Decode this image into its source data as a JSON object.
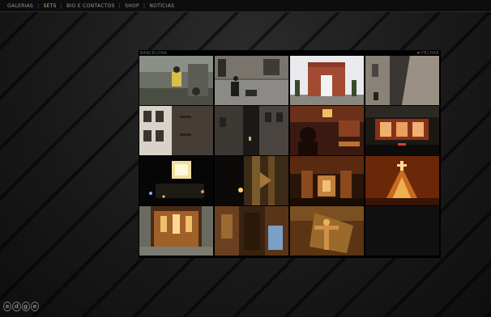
{
  "nav": {
    "items": [
      {
        "label": "GALERIAS",
        "active": false
      },
      {
        "label": "SETS",
        "active": true
      },
      {
        "label": "BIO E CONTACTOS",
        "active": false
      },
      {
        "label": "SHOP",
        "active": false
      },
      {
        "label": "NOTÍCIAS",
        "active": false
      }
    ],
    "separator": "|",
    "active_color": "#9ad14a"
  },
  "gallery": {
    "title": "BARCELONA",
    "close_label": "FECHAR",
    "close_icon": "x-icon",
    "thumbnails": [
      {
        "name": "street-performer"
      },
      {
        "name": "plaza-scooter"
      },
      {
        "name": "arc-de-triomf"
      },
      {
        "name": "gothic-alley-wall"
      },
      {
        "name": "narrow-street-balconies"
      },
      {
        "name": "dark-alley-buildings"
      },
      {
        "name": "cafe-interior-person"
      },
      {
        "name": "shop-window-night"
      },
      {
        "name": "night-stage-lights"
      },
      {
        "name": "cathedral-pillar"
      },
      {
        "name": "church-nave-arches"
      },
      {
        "name": "golden-altar"
      },
      {
        "name": "ornate-altarpiece"
      },
      {
        "name": "stained-glass-arch"
      },
      {
        "name": "crucifix-sculpture"
      },
      {
        "name": "empty"
      }
    ]
  },
  "logo": {
    "letters": [
      "e",
      "d",
      "g",
      "e"
    ]
  }
}
